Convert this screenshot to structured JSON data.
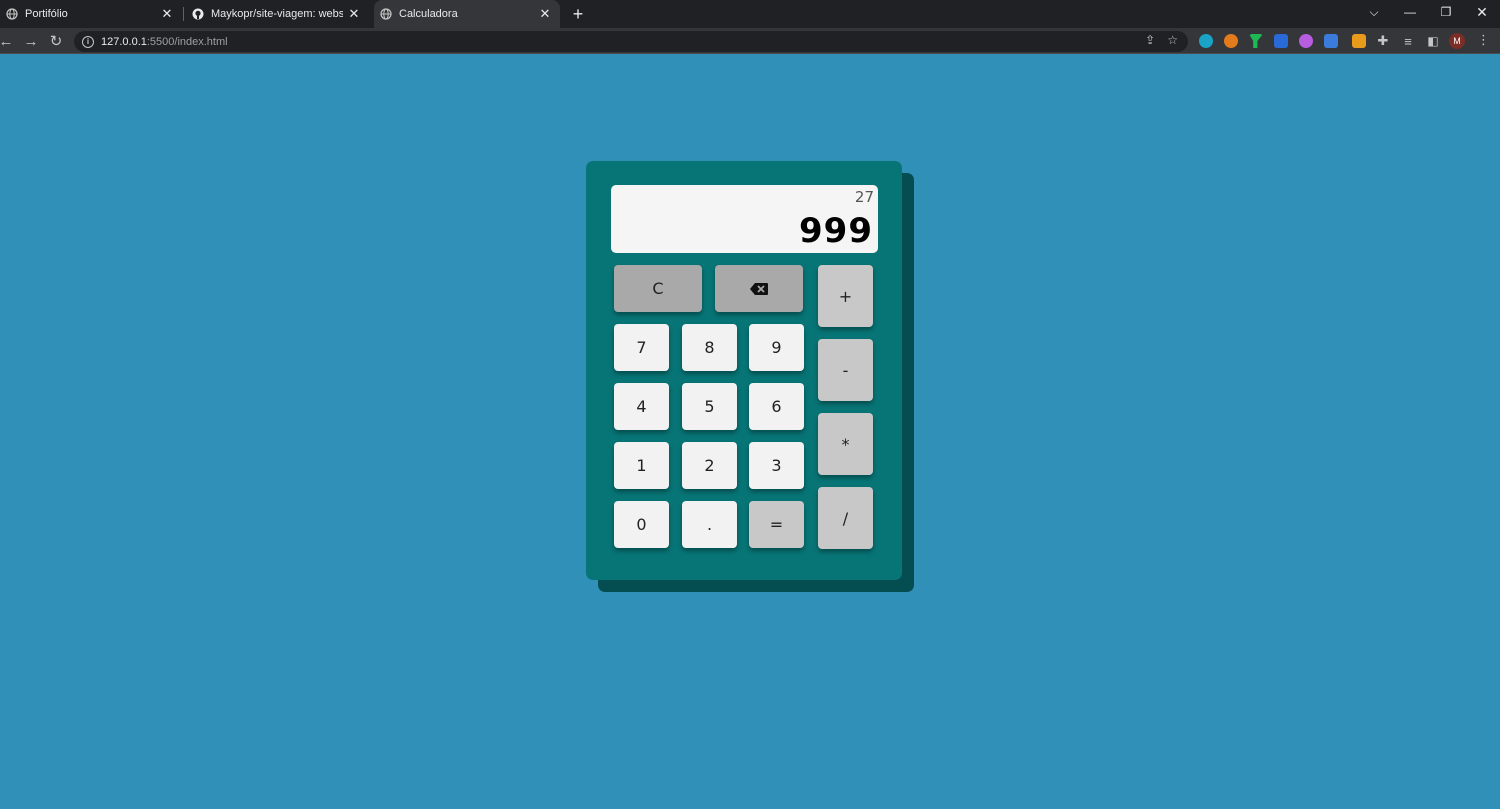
{
  "browser": {
    "tabs": [
      {
        "title": "Portifólio",
        "active": false
      },
      {
        "title": "Maykopr/site-viagem: website si",
        "active": false
      },
      {
        "title": "Calculadora",
        "active": true
      }
    ],
    "url_host": "127.0.0.1",
    "url_path": ":5500/index.html",
    "profile_initial": "M"
  },
  "calculator": {
    "previous_operand": "27",
    "current_operand": "999",
    "keys": {
      "clear": "C",
      "plus": "+",
      "minus": "-",
      "multiply": "*",
      "divide": "/",
      "seven": "7",
      "eight": "8",
      "nine": "9",
      "four": "4",
      "five": "5",
      "six": "6",
      "one": "1",
      "two": "2",
      "three": "3",
      "zero": "0",
      "dot": ".",
      "equals": "="
    },
    "colors": {
      "page_background": "#3190b8",
      "body": "#077576",
      "body_shadow": "#044e52",
      "display": "#f5f5f5",
      "number_key": "#f2f2f2",
      "function_key": "#a9a9a9",
      "operator_key": "#c8c8c8"
    }
  }
}
